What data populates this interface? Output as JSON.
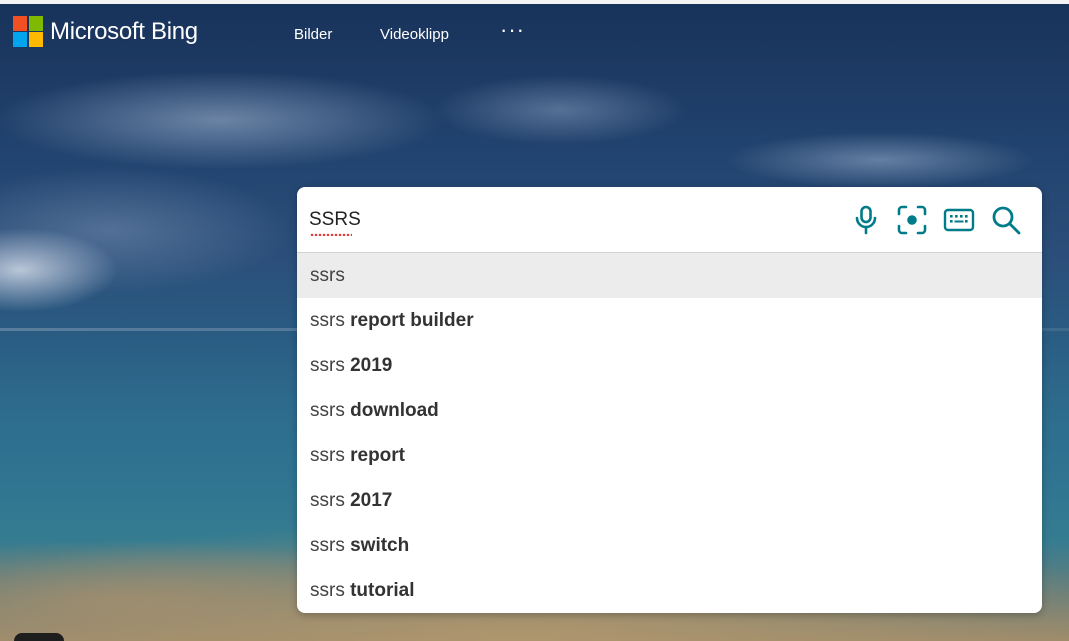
{
  "brand": {
    "name": "Microsoft Bing",
    "logo_colors": [
      "#f25022",
      "#7fba00",
      "#00a4ef",
      "#ffb900"
    ]
  },
  "nav": {
    "items": [
      {
        "label": "Bilder"
      },
      {
        "label": "Videoklipp"
      }
    ],
    "more_label": "···"
  },
  "search": {
    "value": "SSRS",
    "icons": [
      "microphone-icon",
      "visual-search-icon",
      "keyboard-icon",
      "search-icon"
    ],
    "accent_color": "#007b8a"
  },
  "suggestions": [
    {
      "prefix": "ssrs",
      "completion": ""
    },
    {
      "prefix": "ssrs",
      "completion": "report builder"
    },
    {
      "prefix": "ssrs",
      "completion": "2019"
    },
    {
      "prefix": "ssrs",
      "completion": "download"
    },
    {
      "prefix": "ssrs",
      "completion": "report"
    },
    {
      "prefix": "ssrs",
      "completion": "2017"
    },
    {
      "prefix": "ssrs",
      "completion": "switch"
    },
    {
      "prefix": "ssrs",
      "completion": "tutorial"
    }
  ]
}
